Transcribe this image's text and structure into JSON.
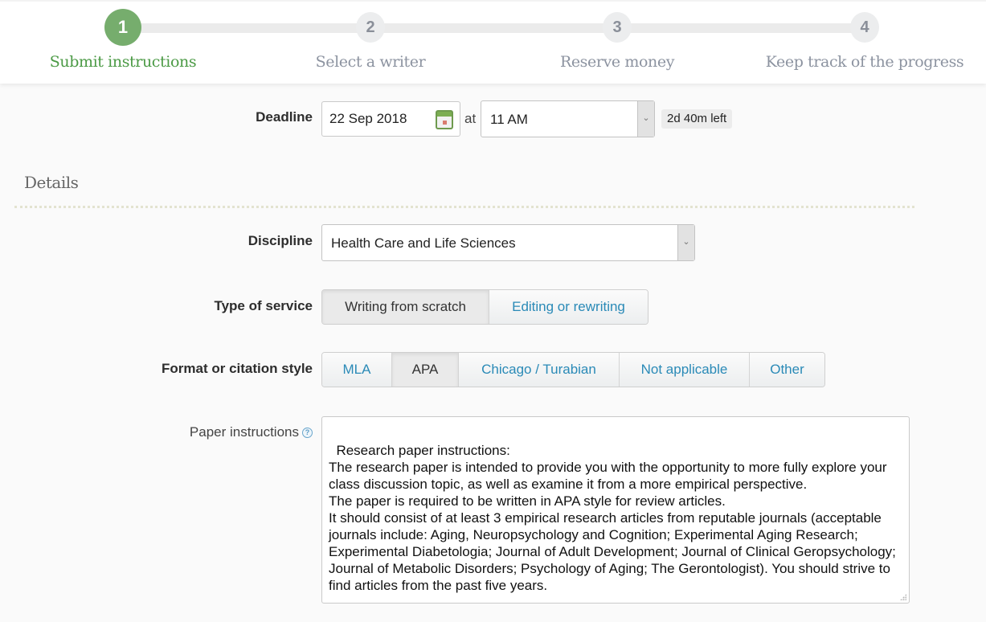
{
  "stepper": {
    "steps": [
      {
        "number": "1",
        "label": "Submit instructions",
        "state": "active"
      },
      {
        "number": "2",
        "label": "Select a writer",
        "state": "inactive"
      },
      {
        "number": "3",
        "label": "Reserve money",
        "state": "inactive"
      },
      {
        "number": "4",
        "label": "Keep track of the progress",
        "state": "inactive"
      }
    ],
    "active_color": "#76ad6d"
  },
  "deadline": {
    "label": "Deadline",
    "date_value": "22 Sep 2018",
    "date_icon": "calendar-icon",
    "at_label": "at",
    "time_value": "11 AM",
    "time_left": "2d 40m left"
  },
  "details": {
    "section_title": "Details",
    "discipline": {
      "label": "Discipline",
      "value": "Health Care and Life Sciences"
    },
    "type_of_service": {
      "label": "Type of service",
      "options": [
        "Writing from scratch",
        "Editing or rewriting"
      ],
      "selected": "Writing from scratch"
    },
    "format": {
      "label": "Format or citation style",
      "options": [
        "MLA",
        "APA",
        "Chicago / Turabian",
        "Not applicable",
        "Other"
      ],
      "selected": "APA"
    },
    "paper_instructions": {
      "label": "Paper instructions",
      "help_icon": "question-mark-icon",
      "value": "Research paper instructions:\nThe research paper is intended to provide you with the opportunity to more fully explore your class discussion topic, as well as examine it from a more empirical perspective.\nThe paper is required to be written in APA style for review articles.\nIt should consist of at least 3 empirical research articles from reputable journals (acceptable journals include: Aging, Neuropsychology and Cognition; Experimental Aging Research; Experimental Diabetologia; Journal of Adult Development; Journal of Clinical Geropsychology; Journal of Metabolic Disorders; Psychology of Aging; The Gerontologist). You should strive to find articles from the past five years."
    }
  },
  "colors": {
    "link_blue": "#2a8ab7",
    "active_green_text": "#4b9a45",
    "inactive_gray": "#8c93a0"
  }
}
